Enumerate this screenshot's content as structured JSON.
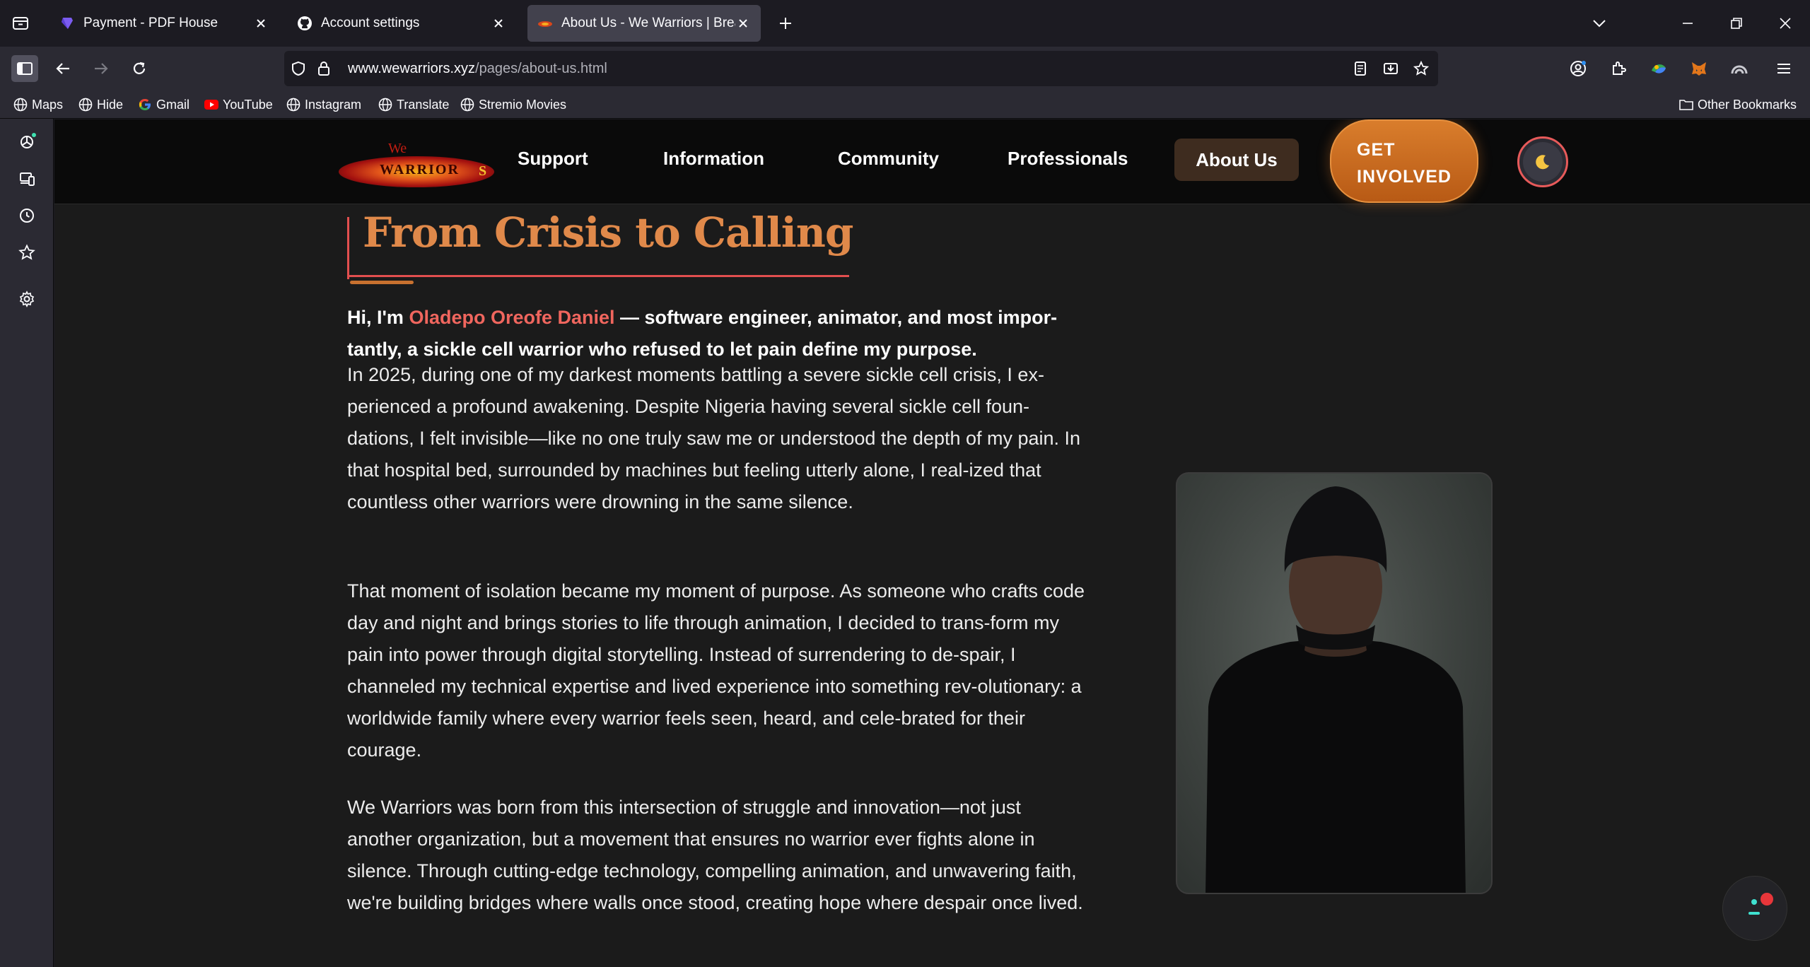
{
  "browser": {
    "tabs": [
      {
        "title": "Payment - PDF House",
        "active": false
      },
      {
        "title": "Account settings",
        "active": false
      },
      {
        "title": "About Us - We Warriors | Breaking",
        "active": true
      }
    ],
    "url_domain": "www.wewarriors.xyz",
    "url_path": "/pages/about-us.html",
    "bookmarks": [
      {
        "label": "Maps",
        "icon": "globe-icon"
      },
      {
        "label": "Hide",
        "icon": "globe-icon"
      },
      {
        "label": "Gmail",
        "icon": "google-icon"
      },
      {
        "label": "YouTube",
        "icon": "youtube-icon"
      },
      {
        "label": "Instagram",
        "icon": "globe-icon"
      },
      {
        "label": "Translate",
        "icon": "globe-icon"
      },
      {
        "label": "Stremio Movies",
        "icon": "globe-icon"
      }
    ],
    "other_bookmarks": "Other Bookmarks",
    "colors": {
      "chrome": "#2b2a33",
      "tabbar": "#1c1b22",
      "active_tab": "#42414d"
    }
  },
  "site": {
    "logo_we": "We",
    "logo_word": "WARRIOR",
    "logo_s": "S",
    "nav": {
      "support": "Support",
      "information": "Information",
      "community": "Community",
      "professionals": "Professionals",
      "about": "About Us"
    },
    "cta_line1": "GET",
    "cta_line2": "INVOLVED",
    "accent": "#e0894a",
    "highlight": "#f0665e"
  },
  "content": {
    "heading": "From Crisis to Calling",
    "lead_prefix": "Hi, I'm ",
    "lead_name": "Oladepo Oreofe Daniel",
    "lead_rest": " — software engineer, animator, and most impor-tantly, a sickle cell warrior who refused to let pain define my purpose.",
    "para1": "In 2025, during one of my darkest moments battling a severe sickle cell crisis, I ex-perienced a profound awakening. Despite Nigeria having several sickle cell foun-dations, I felt invisible—like no one truly saw me or understood the depth of my pain. In that hospital bed, surrounded by machines but feeling utterly alone, I real-ized that countless other warriors were drowning in the same silence.",
    "para2": "That moment of isolation became my moment of purpose. As someone who crafts code day and night and brings stories to life through animation, I decided to trans-form my pain into power through digital storytelling. Instead of surrendering to de-spair, I channeled my technical expertise and lived experience into something rev-olutionary: a worldwide family where every warrior feels seen, heard, and cele-brated for their courage.",
    "para3": "We Warriors was born from this intersection of struggle and innovation—not just another organization, but a movement that ensures no warrior ever fights alone in silence. Through cutting-edge technology, compelling animation, and unwavering faith, we're building bridges where walls once stood, creating hope where despair once lived."
  }
}
